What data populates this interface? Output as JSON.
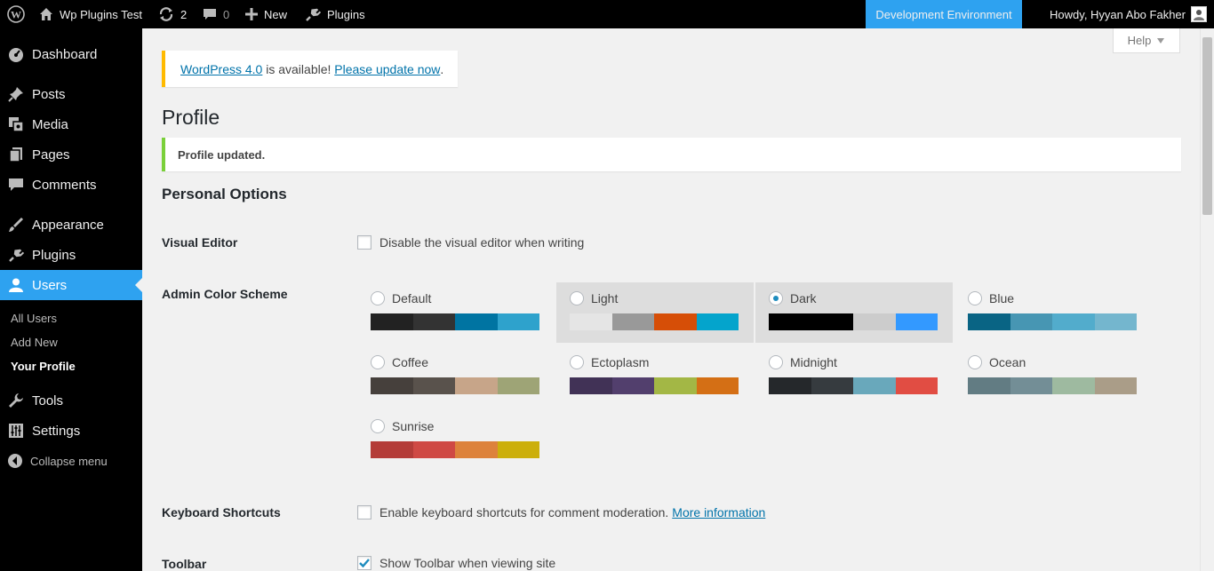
{
  "adminbar": {
    "site_name": "Wp Plugins Test",
    "updates_count": "2",
    "comments_count": "0",
    "new_label": "New",
    "plugins_label": "Plugins",
    "environment_label": "Development Environment",
    "account_label": "Howdy, Hyyan Abo Fakher"
  },
  "sidebar": {
    "items": [
      {
        "label": "Dashboard",
        "icon": "dashboard-icon"
      },
      {
        "label": "Posts",
        "icon": "pin-icon"
      },
      {
        "label": "Media",
        "icon": "media-icon"
      },
      {
        "label": "Pages",
        "icon": "pages-icon"
      },
      {
        "label": "Comments",
        "icon": "comment-icon"
      },
      {
        "label": "Appearance",
        "icon": "brush-icon"
      },
      {
        "label": "Plugins",
        "icon": "plug-icon"
      },
      {
        "label": "Users",
        "icon": "user-icon"
      },
      {
        "label": "Tools",
        "icon": "wrench-icon"
      },
      {
        "label": "Settings",
        "icon": "sliders-icon"
      }
    ],
    "submenu": [
      "All Users",
      "Add New",
      "Your Profile"
    ],
    "collapse_label": "Collapse menu"
  },
  "help_label": "Help",
  "update_nag": {
    "link1": "WordPress 4.0",
    "text": " is available! ",
    "link2": "Please update now",
    "suffix": "."
  },
  "page_title": "Profile",
  "notice": "Profile updated.",
  "section_title": "Personal Options",
  "visual_editor": {
    "label": "Visual Editor",
    "checkbox_label": "Disable the visual editor when writing",
    "checked": false
  },
  "color_scheme": {
    "label": "Admin Color Scheme",
    "selected": "Dark",
    "schemes": [
      {
        "name": "Default",
        "colors": [
          "#222222",
          "#333333",
          "#0074a2",
          "#2ea2cc"
        ]
      },
      {
        "name": "Light",
        "colors": [
          "#e5e5e5",
          "#999999",
          "#d64e07",
          "#04a4cc"
        ]
      },
      {
        "name": "Dark",
        "colors": [
          "#000000",
          "#000000",
          "#cccccc",
          "#3399ff"
        ]
      },
      {
        "name": "Blue",
        "colors": [
          "#096484",
          "#4796b3",
          "#52accc",
          "#74b6ce"
        ]
      },
      {
        "name": "Coffee",
        "colors": [
          "#46403c",
          "#59524c",
          "#c7a589",
          "#9ea476"
        ]
      },
      {
        "name": "Ectoplasm",
        "colors": [
          "#413256",
          "#523f6d",
          "#a3b745",
          "#d46f15"
        ]
      },
      {
        "name": "Midnight",
        "colors": [
          "#25282b",
          "#363b3f",
          "#69a8bb",
          "#e14d43"
        ]
      },
      {
        "name": "Ocean",
        "colors": [
          "#627c83",
          "#738e96",
          "#9ebaa0",
          "#aa9d88"
        ]
      },
      {
        "name": "Sunrise",
        "colors": [
          "#b43c38",
          "#cf4944",
          "#dd823b",
          "#ccaf0b"
        ]
      }
    ]
  },
  "keyboard_shortcuts": {
    "label": "Keyboard Shortcuts",
    "checkbox_label": "Enable keyboard shortcuts for comment moderation.",
    "link": "More information",
    "checked": false
  },
  "toolbar": {
    "label": "Toolbar",
    "checkbox_label": "Show Toolbar when viewing site",
    "checked": true
  }
}
